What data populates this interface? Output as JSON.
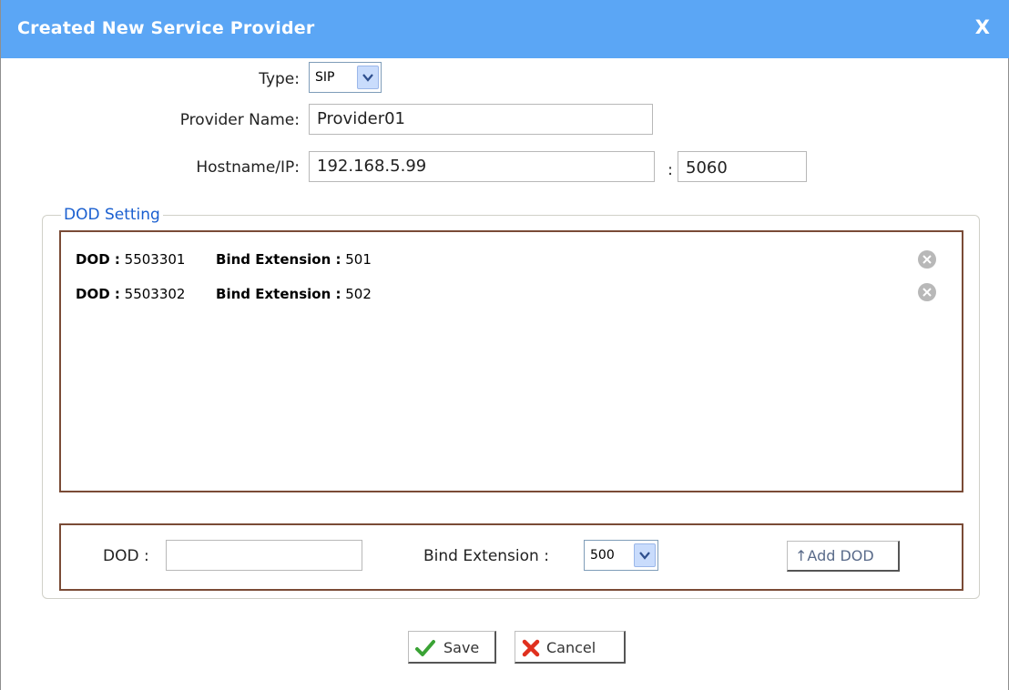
{
  "dialog": {
    "title": "Created New Service Provider",
    "close_label": "X"
  },
  "form": {
    "type_label": "Type:",
    "type_value": "SIP",
    "provider_name_label": "Provider Name:",
    "provider_name_value": "Provider01",
    "hostname_label": "Hostname/IP:",
    "hostname_value": "192.168.5.99",
    "port_separator": ":",
    "port_value": "5060"
  },
  "dod_setting": {
    "legend": "DOD Setting",
    "dod_key": "DOD :",
    "bind_key": "Bind Extension :",
    "entries": [
      {
        "dod": "5503301",
        "extension": "501"
      },
      {
        "dod": "5503302",
        "extension": "502"
      }
    ]
  },
  "add_dod": {
    "dod_label": "DOD :",
    "dod_value": "",
    "bind_label": "Bind Extension :",
    "bind_value": "500",
    "button_label": "↑Add DOD"
  },
  "footer": {
    "save_label": "Save",
    "cancel_label": "Cancel"
  },
  "icons": {
    "close": "close-icon",
    "delete": "remove-circle-icon",
    "dropdown": "chevron-down-icon",
    "save": "checkmark-icon",
    "cancel": "x-icon"
  },
  "colors": {
    "titlebar": "#5ba6f5",
    "legend": "#1a5fd0",
    "panel_border": "#7a4b36",
    "save_check": "#3aa335",
    "cancel_x": "#e0301e"
  }
}
